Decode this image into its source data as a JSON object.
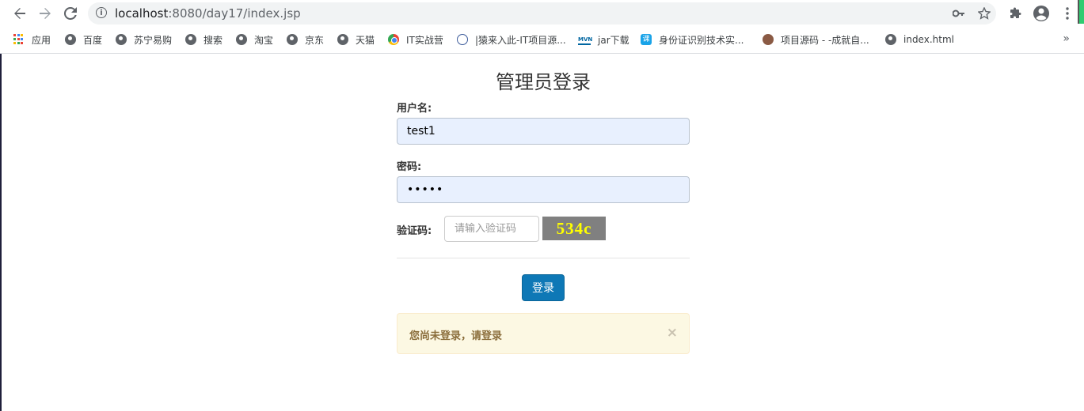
{
  "browser": {
    "url_host": "localhost",
    "url_rest": ":8080/day17/index.jsp"
  },
  "bookmarks": [
    {
      "label": "应用",
      "icon": "apps-grid-icon"
    },
    {
      "label": "百度",
      "icon": "globe-icon"
    },
    {
      "label": "苏宁易购",
      "icon": "globe-icon"
    },
    {
      "label": "搜索",
      "icon": "globe-icon"
    },
    {
      "label": "淘宝",
      "icon": "globe-icon"
    },
    {
      "label": "京东",
      "icon": "globe-icon"
    },
    {
      "label": "天猫",
      "icon": "globe-icon"
    },
    {
      "label": "IT实战营",
      "icon": "chrome-icon"
    },
    {
      "label": "|猿来入此-IT项目源...",
      "icon": "owl-icon"
    },
    {
      "label": "jar下载",
      "icon": "mvn-icon"
    },
    {
      "label": "身份证识别技术实...",
      "icon": "ke-icon"
    },
    {
      "label": "项目源码 - -成就自...",
      "icon": "person-icon"
    },
    {
      "label": "index.html",
      "icon": "globe-icon"
    }
  ],
  "bookmark_more": "»",
  "mvn_text": "MVN",
  "ke_text": "课",
  "page": {
    "title": "管理员登录",
    "username_label": "用户名:",
    "username_value": "test1",
    "password_label": "密码:",
    "password_value": "•••••",
    "captcha_label": "验证码:",
    "captcha_placeholder": "请输入验证码",
    "captcha_image_text": "534c",
    "login_button": "登录",
    "alert_text": "您尚未登录，请登录",
    "alert_close": "×"
  },
  "colors": {
    "login_button": "#0e78b6",
    "alert_bg": "#fcf8e3",
    "alert_text": "#8a6d3b",
    "captcha_bg": "#808080",
    "captcha_text": "#ffff00",
    "autofill_bg": "#e8f0fe"
  }
}
